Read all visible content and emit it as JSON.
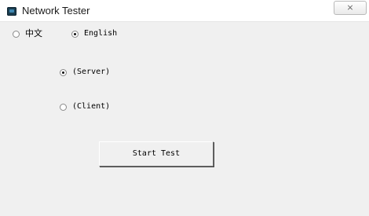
{
  "window": {
    "title": "Network Tester",
    "close_symbol": "⨯"
  },
  "language": {
    "options": [
      {
        "label": "中文",
        "selected": false
      },
      {
        "label": "English",
        "selected": true
      }
    ]
  },
  "mode": {
    "options": [
      {
        "label": "(Server)",
        "selected": true
      },
      {
        "label": "(Client)",
        "selected": false
      }
    ]
  },
  "actions": {
    "start_label": "Start Test"
  }
}
